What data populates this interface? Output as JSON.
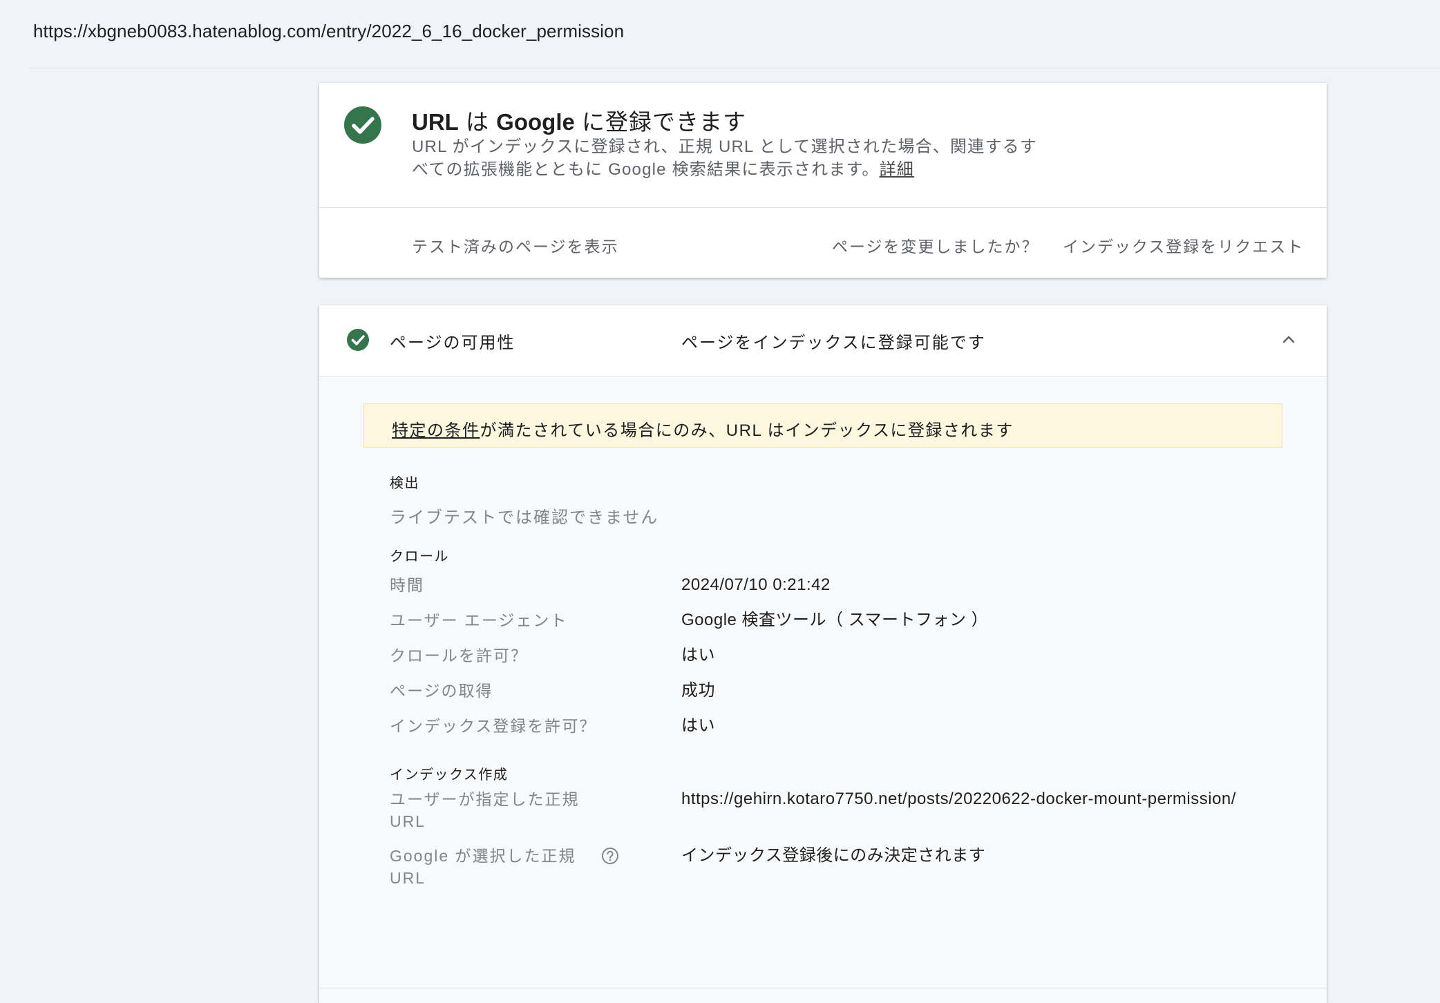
{
  "page": {
    "url": "https://xbgneb0083.hatenablog.com/entry/2022_6_16_docker_permission"
  },
  "status_card": {
    "title_prefix": "URL",
    "title_mid1": " は ",
    "title_brand": "Google",
    "title_suffix": " に登録できます",
    "description": "URL がインデックスに登録され、正規 URL として選択された場合、関連するすべての拡張機能とともに Google 検索結果に表示されます。",
    "description_line1": "URL がインデックスに登録され、正規 URL として選択された場合、関連するす",
    "description_line2": "べての拡張機能とともに Google 検索結果に表示されます。",
    "details_link": "詳細",
    "actions": {
      "view_tested_page": "テスト済みのページを表示",
      "page_changed": "ページを変更しましたか？",
      "request_indexing": "インデックス登録をリクエスト"
    },
    "accent_color": "#34754c"
  },
  "availability": {
    "label": "ページの可用性",
    "value": "ページをインデックスに登録可能です",
    "notice": {
      "link_text": "特定の条件",
      "text": "が満たされている場合にのみ、URL はインデックスに登録されます"
    },
    "discovery": {
      "title": "検出",
      "message": "ライブテストでは確認できません"
    },
    "crawl": {
      "title": "クロール",
      "rows": [
        {
          "label": "時間",
          "value": "2024/07/10 0:21:42"
        },
        {
          "label": "ユーザー エージェント",
          "value": "Google 検査ツール（ スマートフォン ）"
        },
        {
          "label": "クロールを許可？",
          "value": "はい"
        },
        {
          "label": "ページの取得",
          "value": "成功"
        },
        {
          "label": "インデックス登録を許可？",
          "value": "はい"
        }
      ]
    },
    "indexing": {
      "title": "インデックス作成",
      "user_canonical_label_1": "ユーザーが指定した正規",
      "user_canonical_label_2": "URL",
      "user_canonical_value": "https://gehirn.kotaro7750.net/posts/20220622-docker-mount-permission/",
      "google_canonical_label_1": "Google が選択した正規",
      "google_canonical_label_2": "URL",
      "google_canonical_value": "インデックス登録後にのみ決定されます"
    }
  }
}
